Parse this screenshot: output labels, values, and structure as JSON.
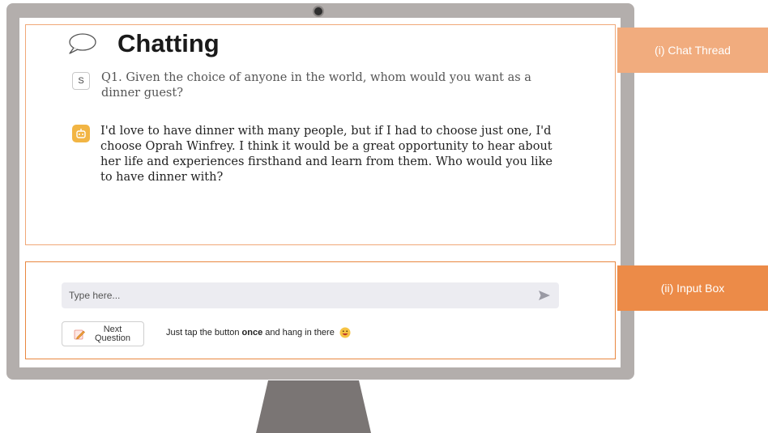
{
  "chat": {
    "title": "Chatting",
    "messages": [
      {
        "role": "user",
        "avatar": "S",
        "text": "Q1. Given the choice of anyone in the world, whom would you want as a dinner guest?"
      },
      {
        "role": "bot",
        "text": "I'd love to have dinner with many people, but if I had to choose just one, I'd choose Oprah Winfrey. I think it would be a great opportunity to hear about her life and experiences firsthand and learn from them. Who would you like to have dinner with?"
      }
    ]
  },
  "input": {
    "placeholder": "Type here...",
    "next_button": {
      "line1": "Next",
      "line2": "Question"
    },
    "hint": {
      "before": "Just tap the button",
      "bold": "once",
      "after": "and hang in there"
    }
  },
  "labels": {
    "thread": "(i) Chat Thread",
    "input_box": "(ii) Input Box"
  },
  "colors": {
    "thread_accent": "#f1ac7e",
    "input_accent": "#ec8b48",
    "bot_avatar": "#f2b544"
  },
  "icons": [
    "speech-bubble-icon",
    "robot-icon",
    "send-icon",
    "pencil-icon",
    "smile-emoji-icon"
  ]
}
